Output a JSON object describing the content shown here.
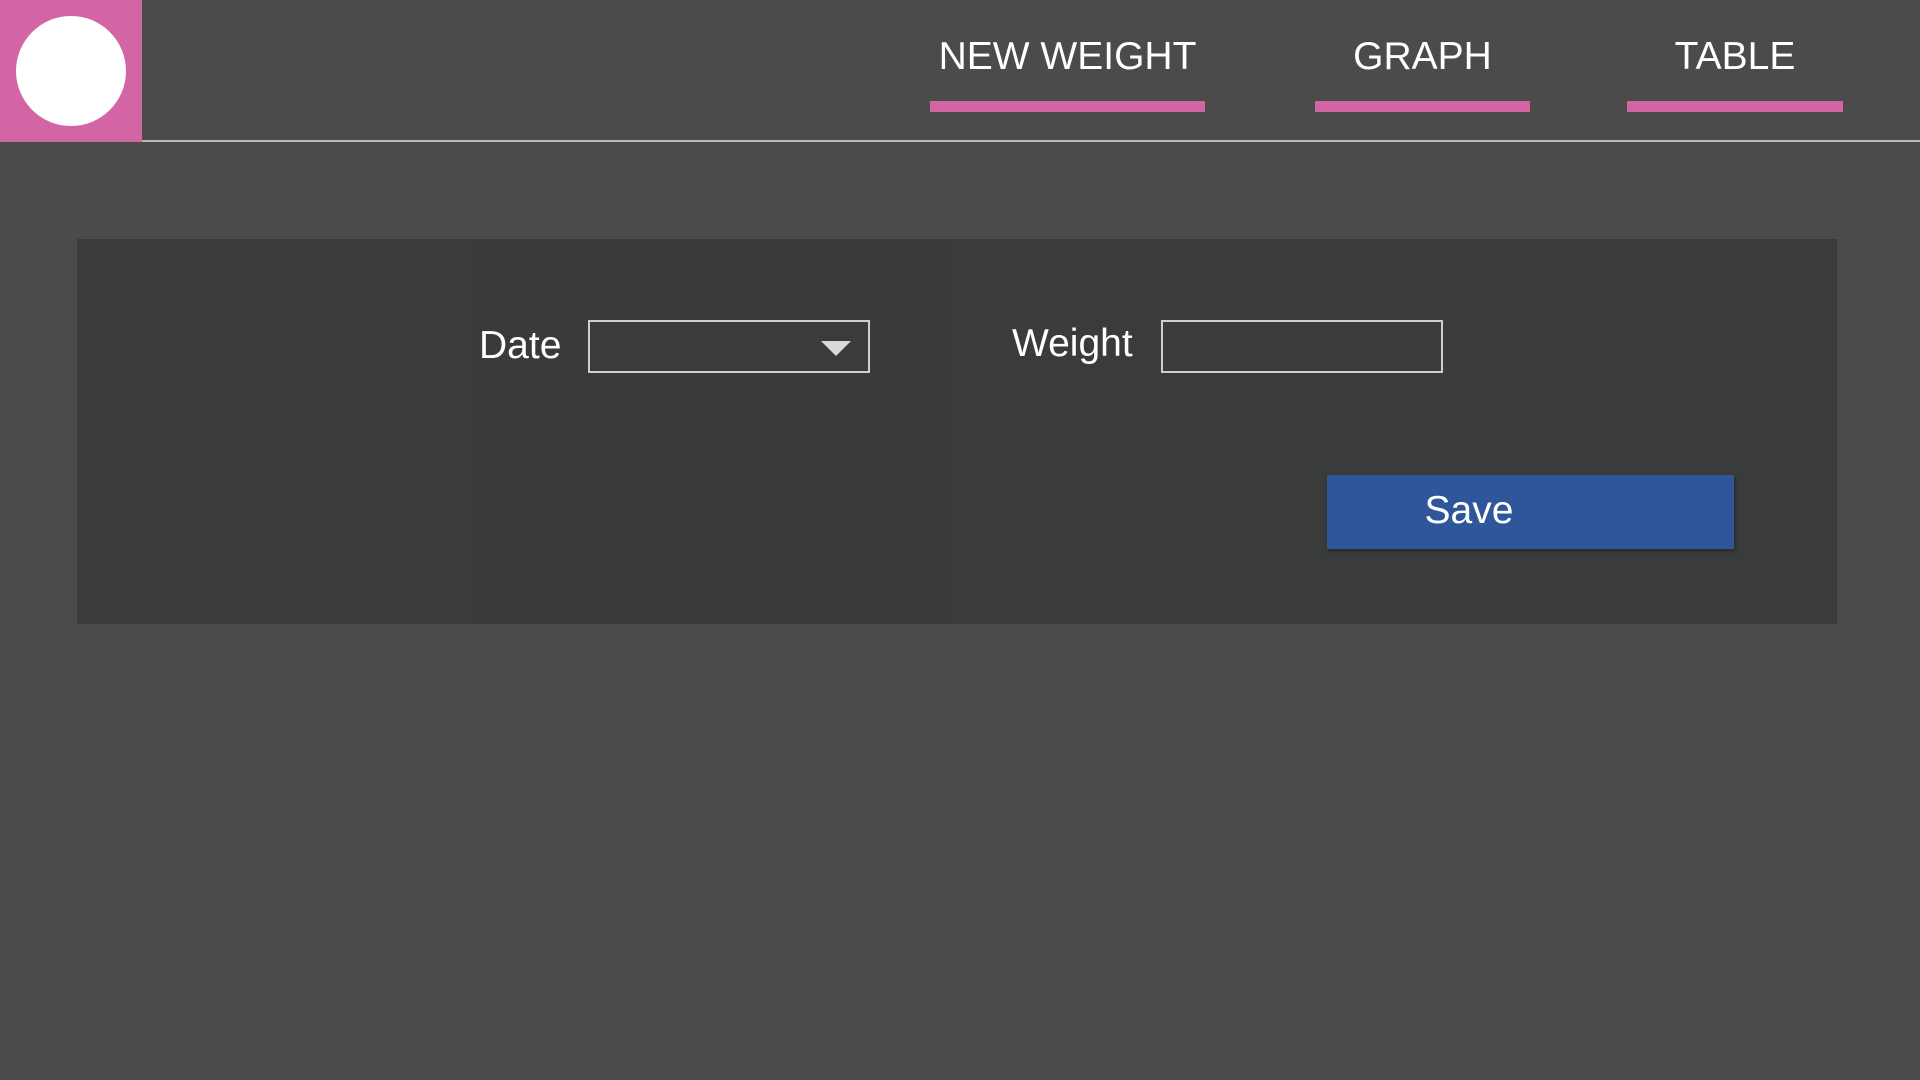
{
  "header": {
    "logo": {
      "icon": "logo-circle-icon",
      "background_color": "#d365a5",
      "circle_color": "#ffffff"
    },
    "tabs": [
      {
        "label": "NEW WEIGHT",
        "active": true
      },
      {
        "label": "GRAPH",
        "active": false
      },
      {
        "label": "TABLE",
        "active": false
      }
    ],
    "accent_color": "#d365a5"
  },
  "form": {
    "date": {
      "label": "Date",
      "value": "",
      "dropdown_icon": "chevron-down-icon"
    },
    "weight": {
      "label": "Weight",
      "value": "",
      "placeholder": ""
    },
    "save_label": "Save",
    "save_color": "#2f569b"
  },
  "colors": {
    "page_background": "#4b4b4b",
    "panel_background": "#3a3b3b"
  }
}
